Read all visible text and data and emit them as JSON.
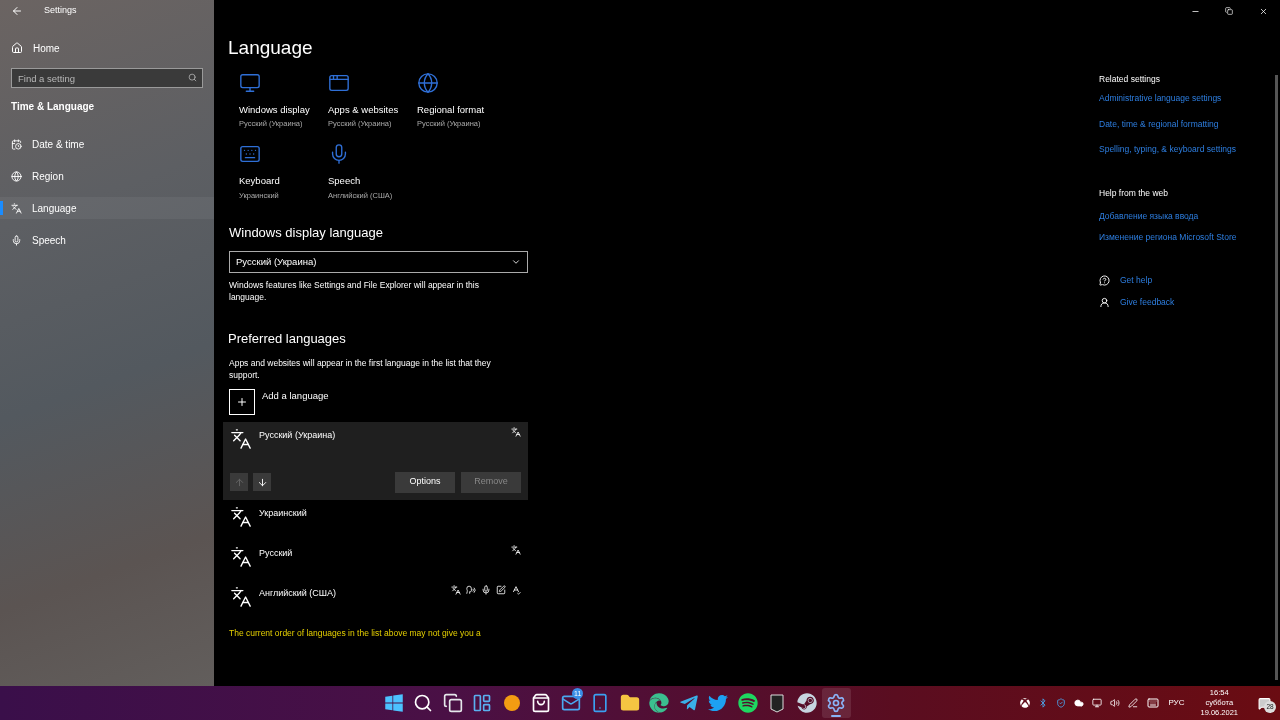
{
  "window": {
    "title": "Settings"
  },
  "sidebar": {
    "home": "Home",
    "search": {
      "placeholder": "Find a setting"
    },
    "section": "Time & Language",
    "items": [
      {
        "kind": "datetime",
        "label": "Date & time",
        "selected": false
      },
      {
        "kind": "region",
        "label": "Region",
        "selected": false
      },
      {
        "kind": "language",
        "label": "Language",
        "selected": true
      },
      {
        "kind": "speech",
        "label": "Speech",
        "selected": false
      }
    ]
  },
  "page": {
    "title": "Language",
    "tiles": [
      {
        "kind": "display",
        "label": "Windows display",
        "value": "Русский (Украина)"
      },
      {
        "kind": "apps",
        "label": "Apps & websites",
        "value": "Русский (Украина)"
      },
      {
        "kind": "region",
        "label": "Regional format",
        "value": "Русский (Украина)"
      },
      {
        "kind": "keyboard",
        "label": "Keyboard",
        "value": "Украинский"
      },
      {
        "kind": "speech",
        "label": "Speech",
        "value": "Английский (США)"
      }
    ]
  },
  "display_language": {
    "heading": "Windows display language",
    "value": "Русский (Украина)",
    "note": "Windows features like Settings and File Explorer will appear in this language."
  },
  "preferred": {
    "heading": "Preferred languages",
    "note": "Apps and websites will appear in the first language in the list that they support.",
    "add": "Add a language",
    "languages": [
      {
        "name": "Русский (Украина)",
        "selected": true,
        "features": [
          {
            "kind": "display"
          }
        ]
      },
      {
        "name": "Украинский",
        "selected": false
      },
      {
        "name": "Русский",
        "selected": false,
        "features": [
          {
            "kind": "display"
          }
        ]
      },
      {
        "name": "Английский (США)",
        "selected": false,
        "features": [
          {
            "kind": "display"
          },
          {
            "kind": "tts"
          },
          {
            "kind": "speech"
          },
          {
            "kind": "handwriting"
          },
          {
            "kind": "spelling"
          }
        ]
      }
    ],
    "move_up_disabled": true,
    "move_down_disabled": false,
    "options": "Options",
    "remove": "Remove",
    "remove_disabled": true,
    "warning": "The current order of languages in the list above may not give you a"
  },
  "related": {
    "heading": "Related settings",
    "links": [
      "Administrative language settings",
      "Date, time & regional formatting",
      "Spelling, typing, & keyboard settings"
    ]
  },
  "help": {
    "heading": "Help from the web",
    "links": [
      "Добавление языка ввода",
      "Изменение региона Microsoft Store"
    ]
  },
  "support": [
    {
      "kind": "help",
      "label": "Get help"
    },
    {
      "kind": "feedback",
      "label": "Give feedback"
    }
  ],
  "taskbar": {
    "apps": [
      {
        "kind": "start",
        "active": false
      },
      {
        "kind": "search",
        "active": false
      },
      {
        "kind": "taskview",
        "active": false
      },
      {
        "kind": "widgets",
        "active": false
      },
      {
        "kind": "orange",
        "active": false
      },
      {
        "kind": "store",
        "active": false
      },
      {
        "kind": "mail",
        "active": false,
        "badge": "11"
      },
      {
        "kind": "phone",
        "active": false
      },
      {
        "kind": "folder",
        "active": false
      },
      {
        "kind": "edge",
        "active": false
      },
      {
        "kind": "telegram",
        "active": false
      },
      {
        "kind": "twitter",
        "active": false
      },
      {
        "kind": "spotify",
        "active": false
      },
      {
        "kind": "epic",
        "active": false
      },
      {
        "kind": "steam",
        "active": false
      },
      {
        "kind": "settings",
        "active": true
      }
    ],
    "tray": {
      "input": "РУС",
      "time": "16:54",
      "day": "суббота",
      "date": "19.06.2021",
      "notifications": "28"
    }
  }
}
